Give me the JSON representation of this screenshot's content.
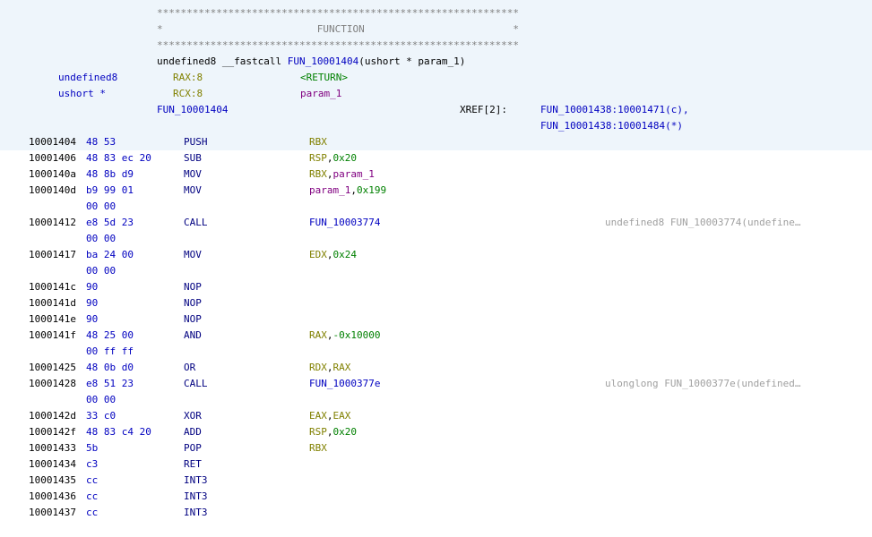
{
  "header": {
    "stars_line": "*************************************************************",
    "function_line": "*                          FUNCTION                         *",
    "signature": {
      "ret_type": "undefined8",
      "calling_conv": "__fastcall",
      "func_name": "FUN_10001404",
      "params": "(ushort * param_1)"
    },
    "vars": [
      {
        "type": "undefined8",
        "storage": "RAX:8",
        "name": "<RETURN>"
      },
      {
        "type": "ushort *",
        "storage": "RCX:8",
        "name": "param_1"
      }
    ],
    "label": "FUN_10001404",
    "xref_label": "XREF[2]:",
    "xrefs": [
      "FUN_10001438:10001471(c),",
      "FUN_10001438:10001484(*)"
    ]
  },
  "instructions": [
    {
      "addr": "10001404",
      "bytes": "48 53",
      "mnem": "PUSH",
      "op1": "RBX",
      "op1c": "reg",
      "sep": "",
      "op2": "",
      "op2c": "",
      "cont": "",
      "comment": ""
    },
    {
      "addr": "10001406",
      "bytes": "48 83 ec 20",
      "mnem": "SUB",
      "op1": "RSP",
      "op1c": "reg",
      "sep": ",",
      "op2": "0x20",
      "op2c": "num",
      "cont": "",
      "comment": ""
    },
    {
      "addr": "1000140a",
      "bytes": "48 8b d9",
      "mnem": "MOV",
      "op1": "RBX",
      "op1c": "reg",
      "sep": ",",
      "op2": "param_1",
      "op2c": "param",
      "cont": "",
      "comment": ""
    },
    {
      "addr": "1000140d",
      "bytes": "b9 99 01",
      "mnem": "MOV",
      "op1": "param_1",
      "op1c": "param",
      "sep": ",",
      "op2": "0x199",
      "op2c": "num",
      "cont": "00 00",
      "comment": ""
    },
    {
      "addr": "10001412",
      "bytes": "e8 5d 23",
      "mnem": "CALL",
      "op1": "FUN_10003774",
      "op1c": "func",
      "sep": "",
      "op2": "",
      "op2c": "",
      "cont": "00 00",
      "comment": "undefined8 FUN_10003774(undefine…"
    },
    {
      "addr": "10001417",
      "bytes": "ba 24 00",
      "mnem": "MOV",
      "op1": "EDX",
      "op1c": "reg",
      "sep": ",",
      "op2": "0x24",
      "op2c": "num",
      "cont": "00 00",
      "comment": ""
    },
    {
      "addr": "1000141c",
      "bytes": "90",
      "mnem": "NOP",
      "op1": "",
      "op1c": "",
      "sep": "",
      "op2": "",
      "op2c": "",
      "cont": "",
      "comment": ""
    },
    {
      "addr": "1000141d",
      "bytes": "90",
      "mnem": "NOP",
      "op1": "",
      "op1c": "",
      "sep": "",
      "op2": "",
      "op2c": "",
      "cont": "",
      "comment": ""
    },
    {
      "addr": "1000141e",
      "bytes": "90",
      "mnem": "NOP",
      "op1": "",
      "op1c": "",
      "sep": "",
      "op2": "",
      "op2c": "",
      "cont": "",
      "comment": ""
    },
    {
      "addr": "1000141f",
      "bytes": "48 25 00",
      "mnem": "AND",
      "op1": "RAX",
      "op1c": "reg",
      "sep": ",",
      "op2": "-0x10000",
      "op2c": "num",
      "cont": "00 ff ff",
      "comment": ""
    },
    {
      "addr": "10001425",
      "bytes": "48 0b d0",
      "mnem": "OR",
      "op1": "RDX",
      "op1c": "reg",
      "sep": ",",
      "op2": "RAX",
      "op2c": "reg",
      "cont": "",
      "comment": ""
    },
    {
      "addr": "10001428",
      "bytes": "e8 51 23",
      "mnem": "CALL",
      "op1": "FUN_1000377e",
      "op1c": "func",
      "sep": "",
      "op2": "",
      "op2c": "",
      "cont": "00 00",
      "comment": "ulonglong FUN_1000377e(undefined…"
    },
    {
      "addr": "1000142d",
      "bytes": "33 c0",
      "mnem": "XOR",
      "op1": "EAX",
      "op1c": "reg",
      "sep": ",",
      "op2": "EAX",
      "op2c": "reg",
      "cont": "",
      "comment": ""
    },
    {
      "addr": "1000142f",
      "bytes": "48 83 c4 20",
      "mnem": "ADD",
      "op1": "RSP",
      "op1c": "reg",
      "sep": ",",
      "op2": "0x20",
      "op2c": "num",
      "cont": "",
      "comment": ""
    },
    {
      "addr": "10001433",
      "bytes": "5b",
      "mnem": "POP",
      "op1": "RBX",
      "op1c": "reg",
      "sep": "",
      "op2": "",
      "op2c": "",
      "cont": "",
      "comment": ""
    },
    {
      "addr": "10001434",
      "bytes": "c3",
      "mnem": "RET",
      "op1": "",
      "op1c": "",
      "sep": "",
      "op2": "",
      "op2c": "",
      "cont": "",
      "comment": ""
    },
    {
      "addr": "10001435",
      "bytes": "cc",
      "mnem": "INT3",
      "op1": "",
      "op1c": "",
      "sep": "",
      "op2": "",
      "op2c": "",
      "cont": "",
      "comment": ""
    },
    {
      "addr": "10001436",
      "bytes": "cc",
      "mnem": "INT3",
      "op1": "",
      "op1c": "",
      "sep": "",
      "op2": "",
      "op2c": "",
      "cont": "",
      "comment": ""
    },
    {
      "addr": "10001437",
      "bytes": "cc",
      "mnem": "INT3",
      "op1": "",
      "op1c": "",
      "sep": "",
      "op2": "",
      "op2c": "",
      "cont": "",
      "comment": ""
    }
  ]
}
